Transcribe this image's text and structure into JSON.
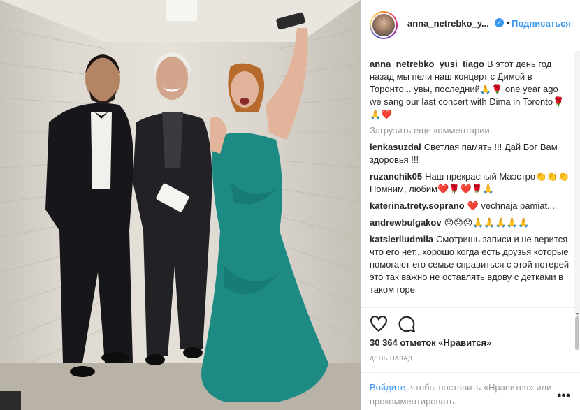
{
  "header": {
    "username": "anna_netrebko_y...",
    "verified_icon": "verified-badge-icon",
    "follow_label": "Подписаться",
    "dot": "•"
  },
  "caption": {
    "user": "anna_netrebko_yusi_tiago",
    "text": "В этот день год назад мы пели наш концерт с Димой в Торонто... увы, последний🙏🌹 one year ago we sang our last concert with Dima in Toronto🌹🙏❤️"
  },
  "load_more": "Загрузить еще комментарии",
  "comments": [
    {
      "user": "lenkasuzdal",
      "text": "Светлая память !!! Дай Бог Вам здоровья !!!"
    },
    {
      "user": "ruzanchik05",
      "text": "Наш прекрасный Маэстро👏👏👏Помним, любим❤️🌹❤️🌹🙏"
    },
    {
      "user": "katerina.trety.soprano",
      "text": "❤️ vechnaja pamiat..."
    },
    {
      "user": "andrewbulgakov",
      "text": "😞😞😞🙏🙏🙏🙏🙏"
    },
    {
      "user": "katslerliudmila",
      "text": "Смотришь записи и не верится что его нет...хорошо когда есть друзья которые помогают его семье справиться с этой потерей это так важно не оставлять вдову с детками в таком горе"
    }
  ],
  "likes": "30 364 отметок «Нравится»",
  "time": "день назад",
  "footer": {
    "login_link": "Войдите",
    "text": ", чтобы поставить «Нравится» или прокомментировать."
  },
  "icons": {
    "like": "heart-icon",
    "comment": "comment-icon",
    "more": "more-options-icon"
  },
  "colors": {
    "link_blue": "#3897f0",
    "text": "#262626",
    "muted": "#999999",
    "dress": "#1d8a84"
  }
}
